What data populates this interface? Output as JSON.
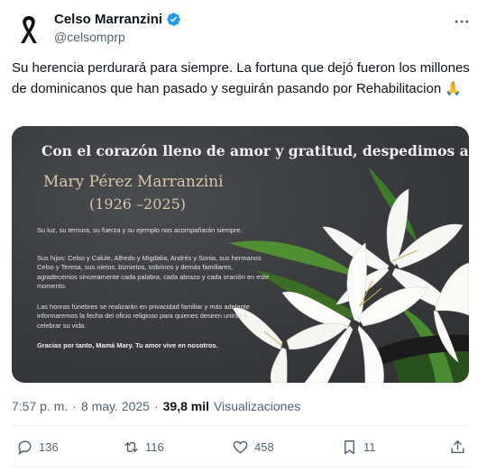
{
  "author": {
    "display_name": "Celso Marranzini",
    "handle": "@celsomprp",
    "avatar_icon": "black-mourning-ribbon-icon",
    "verified_color": "#1d9bf0"
  },
  "tweet": {
    "text": "Su herencia perdurará para siempre. La fortuna que dejó fueron los millones de dominicanos que han pasado y seguirán pasando por Rehabilitacion 🙏"
  },
  "card": {
    "intro": "Con el corazón lleno de amor y gratitud, despedimos a:",
    "name": "Mary Pérez Marranzini",
    "years": "(1926 –2025)",
    "paragraph_1": "Su luz, su ternura, su fuerza y su ejemplo nos acompañarán siempre.",
    "paragraph_2": "Sus hijos: Celso y Calule, Alfredo y Migdalia, Andrés y Sonia, sus hermanos Celso y Teresa, sus nietos, biznietos, sobrinos y demás familiares, agradecemos sinceramente cada palabra, cada abrazo y cada oración en este momento.",
    "paragraph_3": "Las honras fúnebres se realizarán en privacidad familiar y más adelante informaremos la fecha del oficio religioso para quienes deseen unirse a celebrar su vida.",
    "closing": "Gracias por tanto, Mamá Mary. Tu amor vive en nosotros."
  },
  "meta": {
    "time": "7:57 p. m.",
    "separator": "·",
    "date": "8 may. 2025",
    "separator2": "·",
    "views": "39,8 mil",
    "views_label": "Visualizaciones"
  },
  "actions": {
    "replies": "136",
    "reposts": "116",
    "likes": "458",
    "bookmarks": "11"
  },
  "colors": {
    "text": "#0f1419",
    "secondary": "#536471",
    "gold": "#d9c7a7"
  }
}
